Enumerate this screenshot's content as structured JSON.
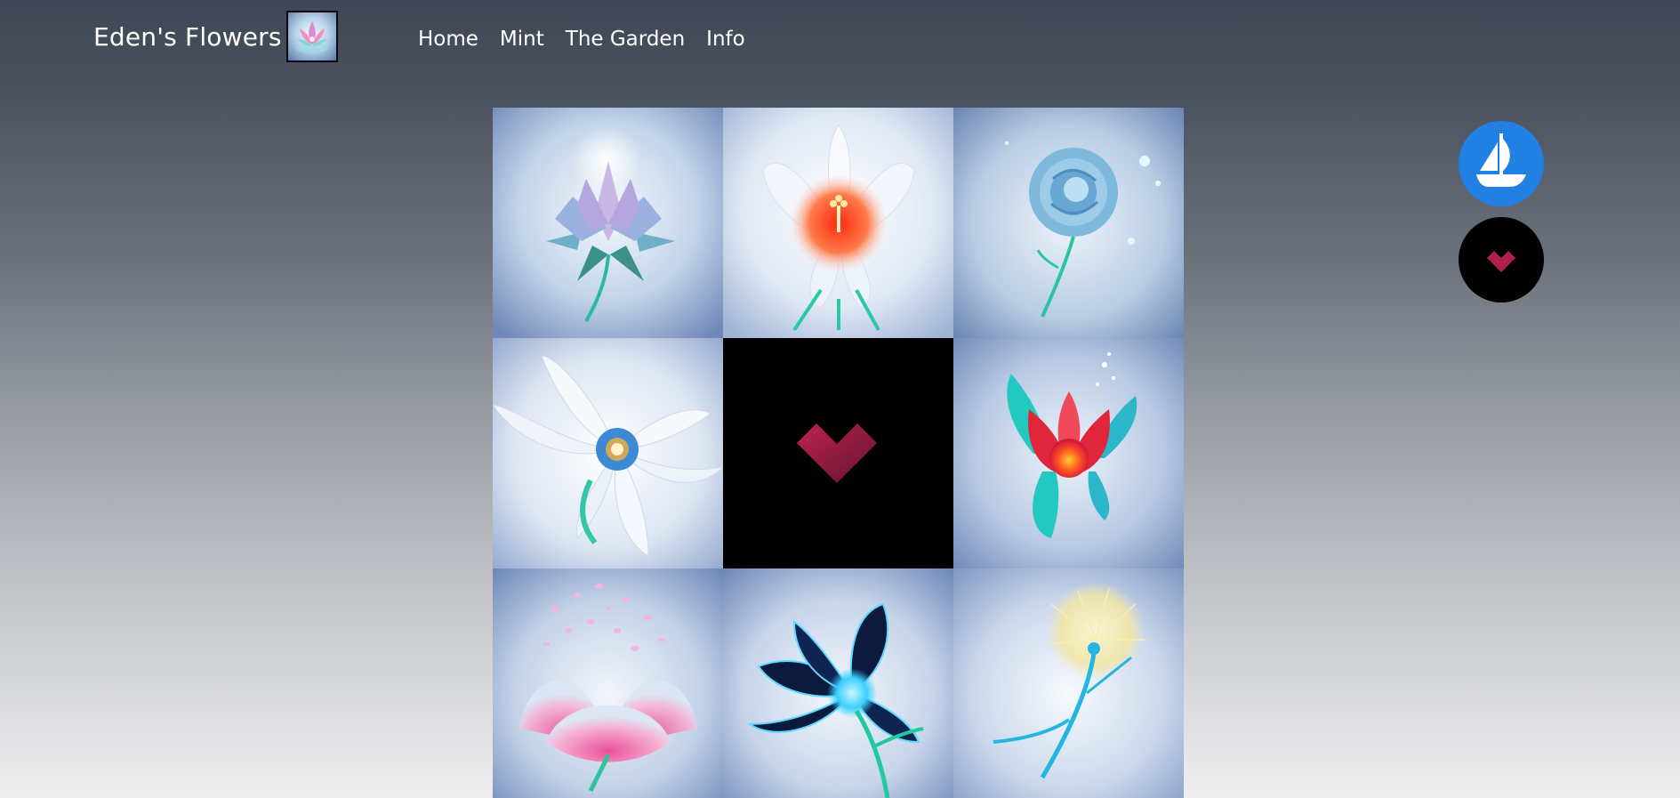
{
  "nav": {
    "brand": "Eden's Flowers",
    "logo_icon": "crystal-lotus-icon",
    "links": [
      "Home",
      "Mint",
      "The Garden",
      "Info"
    ]
  },
  "gallery": {
    "tiles": [
      {
        "subject": "crystal-lotus-flower",
        "palette": [
          "#cfe0f2",
          "#8fa8d6",
          "#2db8a3"
        ]
      },
      {
        "subject": "white-lily-with-orange-center",
        "palette": [
          "#eef2f8",
          "#ff4d1f",
          "#29c8a8"
        ]
      },
      {
        "subject": "blue-glowing-rose",
        "palette": [
          "#d2e3f3",
          "#63a9d6",
          "#2cc3a5"
        ]
      },
      {
        "subject": "white-daisy-swirl",
        "palette": [
          "#e9eef6",
          "#3c8ad6",
          "#33c6aa"
        ]
      },
      {
        "subject": "pixel-heart-logo",
        "palette": [
          "#000000",
          "#c1224f",
          "#5f1530"
        ]
      },
      {
        "subject": "red-lotus-teal-petals",
        "palette": [
          "#dbe6f3",
          "#e0263a",
          "#22c9c0"
        ]
      },
      {
        "subject": "pink-petal-flower",
        "palette": [
          "#dde6f2",
          "#e8509a",
          "#2fc39a"
        ]
      },
      {
        "subject": "dark-blue-glowing-flower",
        "palette": [
          "#d9e5f2",
          "#0b1a3d",
          "#39d0ff"
        ]
      },
      {
        "subject": "glowing-dandelion",
        "palette": [
          "#dfe8f3",
          "#f3e6a1",
          "#23b6e0"
        ]
      }
    ]
  },
  "side_buttons": {
    "opensea_icon": "opensea-boat-icon",
    "heart_icon": "pixel-heart-icon",
    "colors": {
      "opensea": "#2081e2",
      "heart_bg": "#000000",
      "heart": "#b01e4a"
    }
  }
}
